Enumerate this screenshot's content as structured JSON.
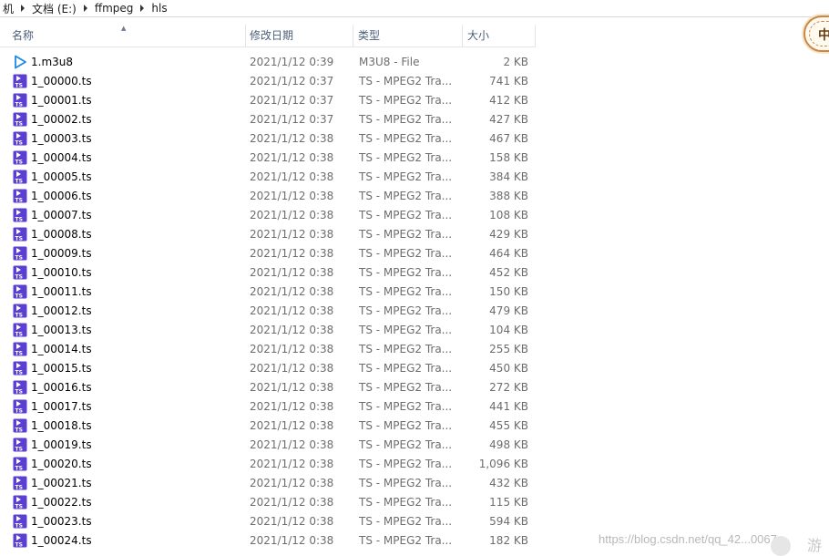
{
  "breadcrumb": {
    "items": [
      "机",
      "文档 (E:)",
      "ffmpeg",
      "hls"
    ]
  },
  "columns": {
    "name": "名称",
    "date": "修改日期",
    "type": "类型",
    "size": "大小"
  },
  "files": [
    {
      "name": "1.m3u8",
      "date": "2021/1/12 0:39",
      "type": "M3U8 - File",
      "size": "2 KB",
      "icon": "play-icon"
    },
    {
      "name": "1_00000.ts",
      "date": "2021/1/12 0:37",
      "type": "TS - MPEG2 Tra...",
      "size": "741 KB",
      "icon": "ts-file-icon"
    },
    {
      "name": "1_00001.ts",
      "date": "2021/1/12 0:37",
      "type": "TS - MPEG2 Tra...",
      "size": "412 KB",
      "icon": "ts-file-icon"
    },
    {
      "name": "1_00002.ts",
      "date": "2021/1/12 0:37",
      "type": "TS - MPEG2 Tra...",
      "size": "427 KB",
      "icon": "ts-file-icon"
    },
    {
      "name": "1_00003.ts",
      "date": "2021/1/12 0:38",
      "type": "TS - MPEG2 Tra...",
      "size": "467 KB",
      "icon": "ts-file-icon"
    },
    {
      "name": "1_00004.ts",
      "date": "2021/1/12 0:38",
      "type": "TS - MPEG2 Tra...",
      "size": "158 KB",
      "icon": "ts-file-icon"
    },
    {
      "name": "1_00005.ts",
      "date": "2021/1/12 0:38",
      "type": "TS - MPEG2 Tra...",
      "size": "384 KB",
      "icon": "ts-file-icon"
    },
    {
      "name": "1_00006.ts",
      "date": "2021/1/12 0:38",
      "type": "TS - MPEG2 Tra...",
      "size": "388 KB",
      "icon": "ts-file-icon"
    },
    {
      "name": "1_00007.ts",
      "date": "2021/1/12 0:38",
      "type": "TS - MPEG2 Tra...",
      "size": "108 KB",
      "icon": "ts-file-icon"
    },
    {
      "name": "1_00008.ts",
      "date": "2021/1/12 0:38",
      "type": "TS - MPEG2 Tra...",
      "size": "429 KB",
      "icon": "ts-file-icon"
    },
    {
      "name": "1_00009.ts",
      "date": "2021/1/12 0:38",
      "type": "TS - MPEG2 Tra...",
      "size": "464 KB",
      "icon": "ts-file-icon"
    },
    {
      "name": "1_00010.ts",
      "date": "2021/1/12 0:38",
      "type": "TS - MPEG2 Tra...",
      "size": "452 KB",
      "icon": "ts-file-icon"
    },
    {
      "name": "1_00011.ts",
      "date": "2021/1/12 0:38",
      "type": "TS - MPEG2 Tra...",
      "size": "150 KB",
      "icon": "ts-file-icon"
    },
    {
      "name": "1_00012.ts",
      "date": "2021/1/12 0:38",
      "type": "TS - MPEG2 Tra...",
      "size": "479 KB",
      "icon": "ts-file-icon"
    },
    {
      "name": "1_00013.ts",
      "date": "2021/1/12 0:38",
      "type": "TS - MPEG2 Tra...",
      "size": "104 KB",
      "icon": "ts-file-icon"
    },
    {
      "name": "1_00014.ts",
      "date": "2021/1/12 0:38",
      "type": "TS - MPEG2 Tra...",
      "size": "255 KB",
      "icon": "ts-file-icon"
    },
    {
      "name": "1_00015.ts",
      "date": "2021/1/12 0:38",
      "type": "TS - MPEG2 Tra...",
      "size": "450 KB",
      "icon": "ts-file-icon"
    },
    {
      "name": "1_00016.ts",
      "date": "2021/1/12 0:38",
      "type": "TS - MPEG2 Tra...",
      "size": "272 KB",
      "icon": "ts-file-icon"
    },
    {
      "name": "1_00017.ts",
      "date": "2021/1/12 0:38",
      "type": "TS - MPEG2 Tra...",
      "size": "441 KB",
      "icon": "ts-file-icon"
    },
    {
      "name": "1_00018.ts",
      "date": "2021/1/12 0:38",
      "type": "TS - MPEG2 Tra...",
      "size": "455 KB",
      "icon": "ts-file-icon"
    },
    {
      "name": "1_00019.ts",
      "date": "2021/1/12 0:38",
      "type": "TS - MPEG2 Tra...",
      "size": "498 KB",
      "icon": "ts-file-icon"
    },
    {
      "name": "1_00020.ts",
      "date": "2021/1/12 0:38",
      "type": "TS - MPEG2 Tra...",
      "size": "1,096 KB",
      "icon": "ts-file-icon"
    },
    {
      "name": "1_00021.ts",
      "date": "2021/1/12 0:38",
      "type": "TS - MPEG2 Tra...",
      "size": "432 KB",
      "icon": "ts-file-icon"
    },
    {
      "name": "1_00022.ts",
      "date": "2021/1/12 0:38",
      "type": "TS - MPEG2 Tra...",
      "size": "115 KB",
      "icon": "ts-file-icon"
    },
    {
      "name": "1_00023.ts",
      "date": "2021/1/12 0:38",
      "type": "TS - MPEG2 Tra...",
      "size": "594 KB",
      "icon": "ts-file-icon"
    },
    {
      "name": "1_00024.ts",
      "date": "2021/1/12 0:38",
      "type": "TS - MPEG2 Tra...",
      "size": "182 KB",
      "icon": "ts-file-icon"
    }
  ],
  "ime": {
    "label": "中"
  },
  "watermark": {
    "text": "https://blog.csdn.net/qq_42...0067",
    "char": "游"
  },
  "colors": {
    "ts_icon": "#5b3fd0",
    "play_icon": "#1e88e5",
    "header_text": "#4c607a",
    "meta_text": "#6d6d6d"
  }
}
